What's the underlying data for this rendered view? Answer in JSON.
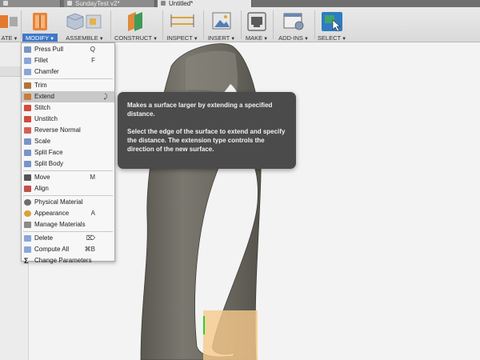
{
  "tabs": [
    {
      "label": "",
      "active": false
    },
    {
      "label": "SundayTest v2*",
      "active": false
    },
    {
      "label": "Untitled*",
      "active": true
    }
  ],
  "toolbar": {
    "groups": [
      {
        "label": "ATE",
        "active": false
      },
      {
        "label": "MODIFY",
        "active": true
      },
      {
        "label": "ASSEMBLE",
        "active": false
      },
      {
        "label": "CONSTRUCT",
        "active": false
      },
      {
        "label": "INSPECT",
        "active": false
      },
      {
        "label": "INSERT",
        "active": false
      },
      {
        "label": "MAKE",
        "active": false
      },
      {
        "label": "ADD-INS",
        "active": false
      },
      {
        "label": "SELECT",
        "active": false
      }
    ],
    "arrow": "▼"
  },
  "menu": {
    "items": [
      {
        "label": "Press Pull",
        "shortcut": "Q",
        "icon": "press-pull-icon",
        "color": "#7a94c9"
      },
      {
        "label": "Fillet",
        "shortcut": "F",
        "icon": "fillet-icon",
        "color": "#8aa6d8"
      },
      {
        "label": "Chamfer",
        "shortcut": "",
        "icon": "chamfer-icon",
        "color": "#8aa6d8"
      },
      {
        "label": "Trim",
        "shortcut": "",
        "icon": "trim-icon",
        "color": "#b0753a"
      },
      {
        "label": "Extend",
        "shortcut": "",
        "icon": "extend-icon",
        "color": "#c97c3b",
        "highlighted": true,
        "pin": "⤸"
      },
      {
        "label": "Stitch",
        "shortcut": "",
        "icon": "stitch-icon",
        "color": "#d24b3b"
      },
      {
        "label": "Unstitch",
        "shortcut": "",
        "icon": "unstitch-icon",
        "color": "#d24b3b"
      },
      {
        "label": "Reverse Normal",
        "shortcut": "",
        "icon": "reverse-normal-icon",
        "color": "#d85e55"
      },
      {
        "label": "Scale",
        "shortcut": "",
        "icon": "scale-icon",
        "color": "#7a94c9"
      },
      {
        "label": "Split Face",
        "shortcut": "",
        "icon": "split-face-icon",
        "color": "#7a94c9"
      },
      {
        "label": "Split Body",
        "shortcut": "",
        "icon": "split-body-icon",
        "color": "#7a94c9"
      },
      {
        "label": "Move",
        "shortcut": "M",
        "icon": "move-icon",
        "color": "#555555"
      },
      {
        "label": "Align",
        "shortcut": "",
        "icon": "align-icon",
        "color": "#c2504a"
      },
      {
        "label": "Physical Material",
        "shortcut": "",
        "icon": "physical-material-icon",
        "color": "#6d6d6d"
      },
      {
        "label": "Appearance",
        "shortcut": "A",
        "icon": "appearance-icon",
        "color": "#d8a23a"
      },
      {
        "label": "Manage Materials",
        "shortcut": "",
        "icon": "manage-materials-icon",
        "color": "#8a8a8a"
      },
      {
        "label": "Delete",
        "shortcut": "⌦",
        "icon": "delete-icon",
        "color": "#8aa6d8"
      },
      {
        "label": "Compute All",
        "shortcut": "⌘B",
        "icon": "compute-all-icon",
        "color": "#8aa6d8"
      },
      {
        "label": "Change Parameters",
        "shortcut": "",
        "icon": "sigma-icon",
        "color": "#222222"
      }
    ]
  },
  "tooltip": {
    "line1": "Makes a surface larger by extending a specified distance.",
    "line2": "Select the edge of the surface to extend and specify the distance. The extension type controls the direction of the new surface."
  },
  "colors": {
    "accent": "#3f78c9",
    "model": "#6c6a62",
    "selection": "#f6c98b"
  }
}
